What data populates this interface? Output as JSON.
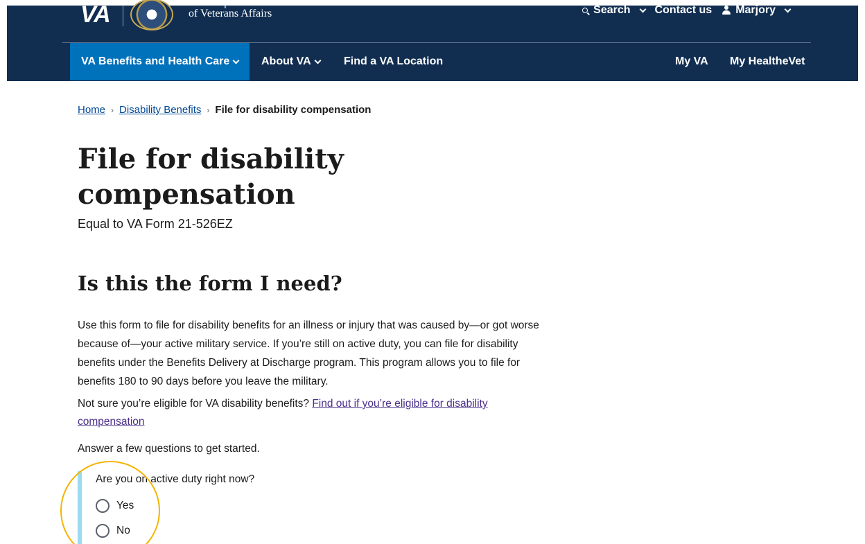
{
  "header": {
    "logo_text": "VA",
    "dept_line1": "U.S. Department",
    "dept_line2": "of Veterans Affairs",
    "search_label": "Search",
    "contact_label": "Contact us",
    "user_label": "Marjory",
    "color": "#112e51"
  },
  "nav": {
    "items": [
      {
        "label": "VA Benefits and Health Care",
        "active": true
      },
      {
        "label": "About VA",
        "active": false
      },
      {
        "label": "Find a VA Location",
        "active": false
      },
      {
        "label": "My VA",
        "active": false
      },
      {
        "label": "My HealtheVet",
        "active": false
      }
    ],
    "active_color": "#0071bb"
  },
  "breadcrumb": {
    "items": [
      "Home",
      "Disability Benefits",
      "File for disability compensation"
    ]
  },
  "page": {
    "title": "File for disability compensation",
    "subtitle": "Equal to VA Form 21-526EZ",
    "section_title": "Is this the form I need?",
    "paragraph1": "Use this form to file for disability benefits for an illness or injury that was caused by—or got worse because of—your active military service. If you’re still on active duty, you can file for disability benefits under the Benefits Delivery at Discharge program. This program allows you to file for benefits 180 to 90 days before you leave the military.",
    "paragraph2_text": "Not sure you’re eligible for VA disability benefits?",
    "paragraph2_link": "Find out if you’re eligible for disability compensation",
    "paragraph3": "Answer a few questions to get started."
  },
  "question": {
    "label": "Are you on active duty right now?",
    "options": [
      "Yes",
      "No"
    ],
    "accent_color": "#9bdaf1",
    "highlight_color": "#f4b400"
  }
}
